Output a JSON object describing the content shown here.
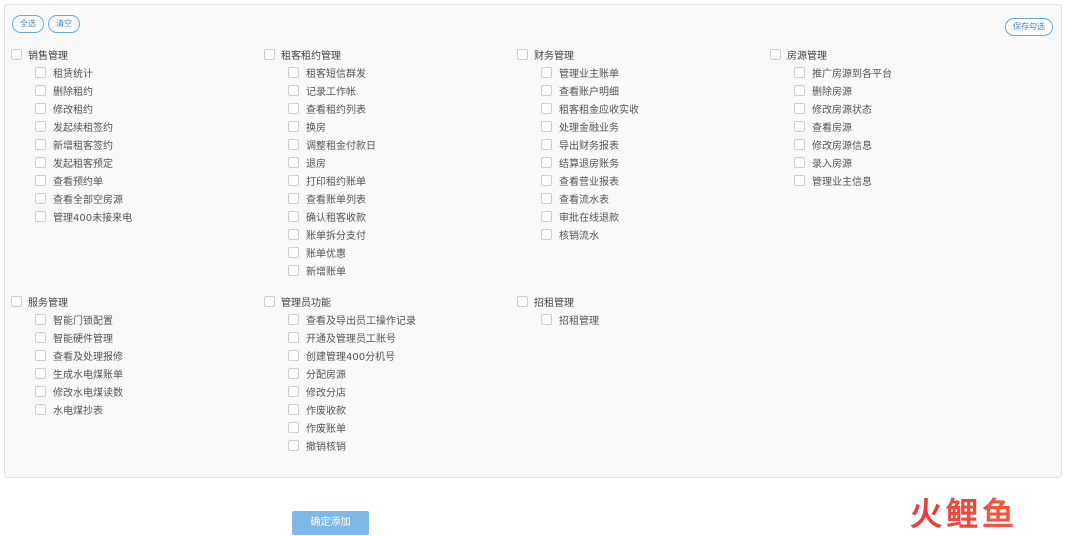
{
  "toolbar": {
    "select_all": "全选",
    "clear": "清空",
    "save_selection": "保存勾选"
  },
  "groups": [
    {
      "title": "销售管理",
      "items": [
        "租赁统计",
        "删除租约",
        "修改租约",
        "发起续租签约",
        "新增租客签约",
        "发起租客预定",
        "查看预约单",
        "查看全部空房源",
        "管理400未接来电"
      ]
    },
    {
      "title": "租客租约管理",
      "items": [
        "租客短信群发",
        "记录工作帐",
        "查看租约列表",
        "换房",
        "调整租金付款日",
        "退房",
        "打印租约账单",
        "查看账单列表",
        "确认租客收款",
        "账单拆分支付",
        "账单优惠",
        "新增账单"
      ]
    },
    {
      "title": "财务管理",
      "items": [
        "管理业主账单",
        "查看账户明细",
        "租客租金应收实收",
        "处理金融业务",
        "导出财务报表",
        "结算退房账务",
        "查看营业报表",
        "查看流水表",
        "审批在线退款",
        "核销流水"
      ]
    },
    {
      "title": "房源管理",
      "items": [
        "推广房源到各平台",
        "删除房源",
        "修改房源状态",
        "查看房源",
        "修改房源信息",
        "录入房源",
        "管理业主信息"
      ]
    },
    {
      "title": "服务管理",
      "items": [
        "智能门锁配置",
        "智能硬件管理",
        "查看及处理报修",
        "生成水电煤账单",
        "修改水电煤读数",
        "水电煤抄表"
      ]
    },
    {
      "title": "管理员功能",
      "items": [
        "查看及导出员工操作记录",
        "开通及管理员工账号",
        "创建管理400分机号",
        "分配房源",
        "修改分店",
        "作废收款",
        "作废账单",
        "撤销核销"
      ]
    },
    {
      "title": "招租管理",
      "items": [
        "招租管理"
      ]
    }
  ],
  "footer": {
    "confirm_add": "确定添加"
  },
  "watermark": {
    "c1": "火",
    "c2": "鲤",
    "c3": "鱼"
  }
}
